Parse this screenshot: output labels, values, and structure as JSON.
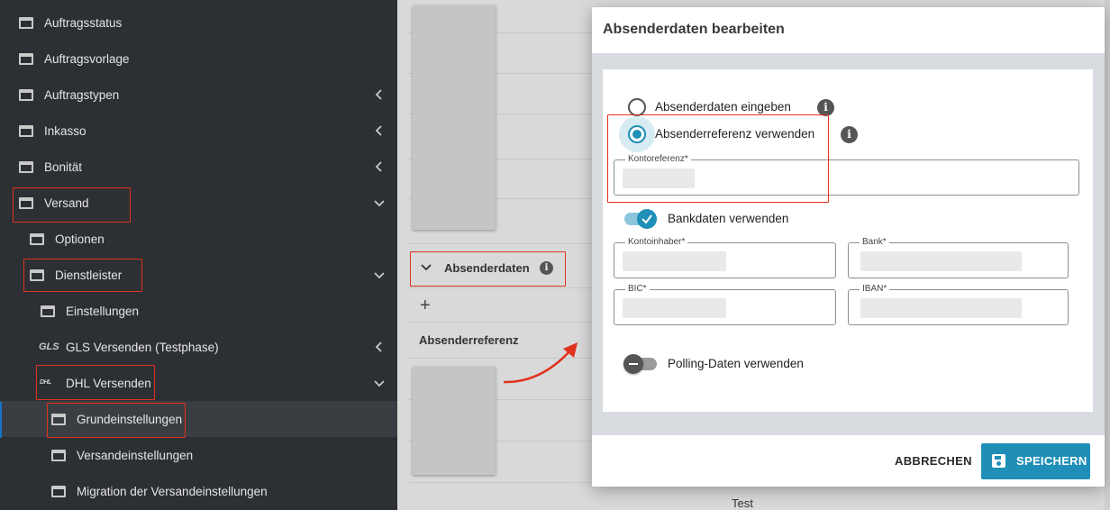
{
  "sidebar": {
    "items": [
      {
        "label": "Auftragsstatus"
      },
      {
        "label": "Auftragsvorlage"
      },
      {
        "label": "Auftragstypen"
      },
      {
        "label": "Inkasso"
      },
      {
        "label": "Bonität"
      },
      {
        "label": "Versand"
      },
      {
        "label": "Optionen"
      },
      {
        "label": "Dienstleister"
      },
      {
        "label": "Einstellungen"
      },
      {
        "label": "GLS Versenden (Testphase)",
        "logo": "GLS"
      },
      {
        "label": "DHL Versenden",
        "logo": "DHL"
      },
      {
        "label": "Grundeinstellungen"
      },
      {
        "label": "Versandeinstellungen"
      },
      {
        "label": "Migration der Versandeinstellungen"
      }
    ]
  },
  "background": {
    "section_title": "Absenderdaten",
    "add_symbol": "+",
    "column_header": "Absenderreferenz",
    "footer_text": "Test"
  },
  "dialog": {
    "title": "Absenderdaten bearbeiten",
    "options": {
      "enter_data": "Absenderdaten eingeben",
      "use_reference": "Absenderreferenz verwenden",
      "selected": "use_reference"
    },
    "fields": {
      "kontoreferenz": "Kontoreferenz*",
      "kontoinhaber": "Kontoinhaber*",
      "bank": "Bank*",
      "bic": "BIC*",
      "iban": "IBAN*"
    },
    "toggles": {
      "bankdaten": {
        "label": "Bankdaten verwenden",
        "on": true
      },
      "polling": {
        "label": "Polling-Daten verwenden",
        "on": false
      }
    },
    "buttons": {
      "cancel": "ABBRECHEN",
      "save": "SPEICHERN"
    },
    "info_symbol": "i"
  },
  "colors": {
    "accent": "#1f8fb8",
    "highlight": "#e0321e",
    "sidebar_bg": "#2c2f33"
  }
}
